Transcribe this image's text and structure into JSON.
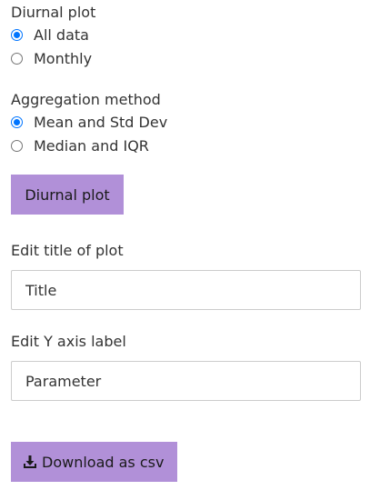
{
  "diurnal_plot": {
    "label": "Diurnal plot",
    "options": [
      {
        "label": "All data",
        "checked": true
      },
      {
        "label": "Monthly",
        "checked": false
      }
    ]
  },
  "aggregation": {
    "label": "Aggregation method",
    "options": [
      {
        "label": "Mean and Std Dev",
        "checked": true
      },
      {
        "label": "Median and IQR",
        "checked": false
      }
    ]
  },
  "buttons": {
    "diurnal_plot": "Diurnal plot",
    "download": "Download as csv"
  },
  "title_field": {
    "label": "Edit title of plot",
    "value": "Title"
  },
  "yaxis_field": {
    "label": "Edit Y axis label",
    "value": "Parameter"
  },
  "icons": {
    "download": "download-icon"
  },
  "colors": {
    "button_bg": "#b190d8",
    "radio_accent": "#0075ff"
  }
}
